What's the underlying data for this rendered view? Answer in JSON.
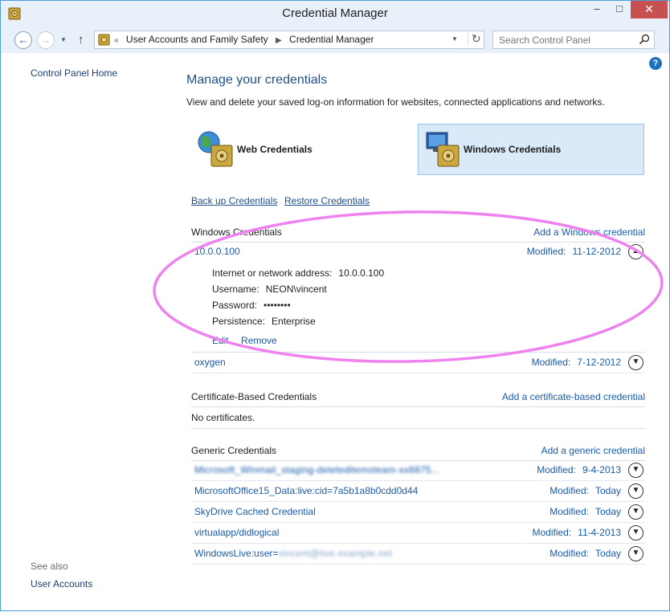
{
  "window": {
    "title": "Credential Manager",
    "close_glyph": "✕",
    "min_glyph": "–",
    "max_glyph": "□"
  },
  "nav": {
    "breadcrumb": [
      "User Accounts and Family Safety",
      "Credential Manager"
    ],
    "breadcrumb_prefix": "«",
    "search_placeholder": "Search Control Panel"
  },
  "sidebar": {
    "home": "Control Panel Home",
    "see_also": "See also",
    "user_accounts": "User Accounts"
  },
  "main": {
    "title": "Manage your credentials",
    "description": "View and delete your saved log-on information for websites, connected applications and networks.",
    "web_credentials": "Web Credentials",
    "windows_credentials": "Windows Credentials",
    "backup_link": "Back up Credentials",
    "restore_link": "Restore Credentials",
    "selected_tab": "windows"
  },
  "windows_section": {
    "header": "Windows Credentials",
    "add_link": "Add a Windows credential",
    "items": [
      {
        "name": "10.0.0.100",
        "modified_label": "Modified:",
        "modified": "11-12-2012",
        "expanded": true,
        "details": {
          "address_label": "Internet or network address:",
          "address": "10.0.0.100",
          "username_label": "Username:",
          "username": "NEON\\vincent",
          "password_label": "Password:",
          "password": "••••••••",
          "persistence_label": "Persistence:",
          "persistence": "Enterprise"
        },
        "edit": "Edit",
        "remove": "Remove"
      },
      {
        "name": "oxygen",
        "modified_label": "Modified:",
        "modified": "7-12-2012",
        "expanded": false
      }
    ]
  },
  "certificate_section": {
    "header": "Certificate-Based Credentials",
    "add_link": "Add a certificate-based credential",
    "empty": "No certificates."
  },
  "generic_section": {
    "header": "Generic Credentials",
    "add_link": "Add a generic credential",
    "items": [
      {
        "name": "Microsoft_Winmail_staging-deleteditemsteam-xx6875...",
        "blurred": true,
        "modified_label": "Modified:",
        "modified": "9-4-2013"
      },
      {
        "name": "MicrosoftOffice15_Data:live:cid=7a5b1a8b0cdd0d44",
        "modified_label": "Modified:",
        "modified": "Today"
      },
      {
        "name": "SkyDrive Cached Credential",
        "modified_label": "Modified:",
        "modified": "Today"
      },
      {
        "name": "virtualapp/didlogical",
        "modified_label": "Modified:",
        "modified": "11-4-2013"
      },
      {
        "name": "WindowsLive:user=",
        "name_blurred_suffix": "vincent@live.example.net",
        "modified_label": "Modified:",
        "modified": "Today"
      }
    ]
  },
  "colors": {
    "accent": "#1a5aa8",
    "selected_bg": "#daeaf9",
    "annotation": "#ee82ee"
  },
  "icons": {
    "app": "credential-safe-icon",
    "help": "help-icon",
    "search": "search-icon"
  }
}
